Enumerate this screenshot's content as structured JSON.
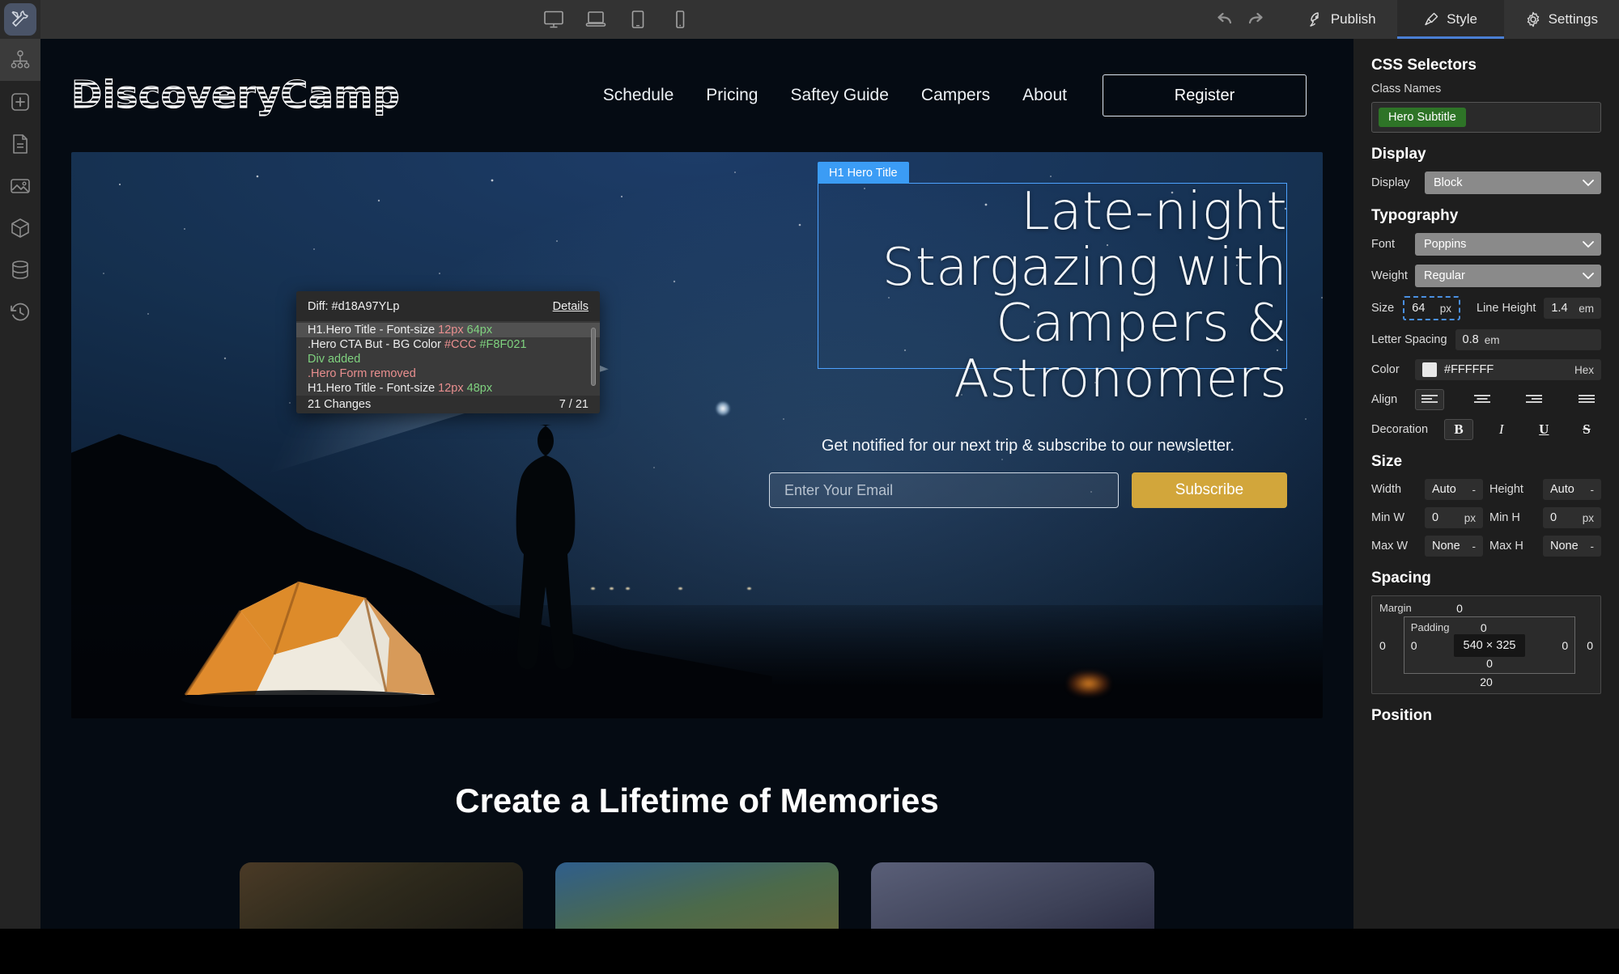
{
  "topbar": {
    "devices": [
      {
        "name": "desktop-view",
        "label": "Desktop"
      },
      {
        "name": "laptop-view",
        "label": "Laptop"
      },
      {
        "name": "tablet-view",
        "label": "Tablet"
      },
      {
        "name": "mobile-view",
        "label": "Mobile"
      }
    ],
    "undo_label": "Undo",
    "redo_label": "Redo",
    "publish_label": "Publish",
    "style_label": "Style",
    "settings_label": "Settings",
    "active_tab": "Style",
    "accent_color": "#4a7fd4"
  },
  "rail": {
    "items": [
      {
        "icon": "tools-icon",
        "label": "Tools",
        "active": true
      },
      {
        "icon": "sitemap-icon",
        "label": "Site Map",
        "active": false
      },
      {
        "icon": "add-box-icon",
        "label": "Add Element",
        "active": false
      },
      {
        "icon": "document-icon",
        "label": "Pages",
        "active": false
      },
      {
        "icon": "image-icon",
        "label": "Media",
        "active": false
      },
      {
        "icon": "cube-icon",
        "label": "Components",
        "active": false
      },
      {
        "icon": "database-icon",
        "label": "Data",
        "active": false
      },
      {
        "icon": "history-icon",
        "label": "History",
        "active": false
      }
    ]
  },
  "site": {
    "logo_text": "DiscoveryCamp",
    "nav": [
      {
        "label": "Schedule"
      },
      {
        "label": "Pricing"
      },
      {
        "label": "Saftey Guide"
      },
      {
        "label": "Campers"
      },
      {
        "label": "About"
      }
    ],
    "register_label": "Register",
    "hero": {
      "badge": "H1 Hero Title",
      "title": "Late-night Stargazing with Campers & Astronomers",
      "subtitle": "Get notified for our next trip & subscribe to our newsletter.",
      "email_placeholder": "Enter Your Email",
      "email_value": "",
      "subscribe_label": "Subscribe",
      "subscribe_color": "#D2A63B",
      "selection_color": "#4DA2FF"
    },
    "section_title": "Create a Lifetime of Memories"
  },
  "diff": {
    "title": "Diff: #d18A97YLp",
    "details_label": "Details",
    "rows": [
      {
        "prefix": "H1.Hero Title - Font-size",
        "old": "12px",
        "new": "64px",
        "kind": "change",
        "selected": true
      },
      {
        "prefix": ".Hero CTA But - BG Color",
        "old": "#CCC",
        "new": "#F8F021",
        "kind": "change",
        "selected": false
      },
      {
        "prefix": "Div added",
        "old": "",
        "new": "",
        "kind": "added",
        "selected": false
      },
      {
        "prefix": ".Hero Form removed",
        "old": "",
        "new": "",
        "kind": "removed",
        "selected": false
      },
      {
        "prefix": "H1.Hero Title - Font-size",
        "old": "12px",
        "new": "48px",
        "kind": "change",
        "selected": false
      }
    ],
    "footer_count": "21 Changes",
    "footer_position": "7 / 21"
  },
  "inspector": {
    "css_selectors_heading": "CSS Selectors",
    "class_names_label": "Class Names",
    "class_chip": "Hero Subtitle",
    "class_chip_color": "#2E7427",
    "display_heading": "Display",
    "display_label": "Display",
    "display_value": "Block",
    "typography_heading": "Typography",
    "font_label": "Font",
    "font_value": "Poppins",
    "weight_label": "Weight",
    "weight_value": "Regular",
    "size_label": "Size",
    "size_value": "64",
    "size_unit": "px",
    "line_height_label": "Line Height",
    "line_height_value": "1.4",
    "line_height_unit": "em",
    "letter_spacing_label": "Letter Spacing",
    "letter_spacing_value": "0.8",
    "letter_spacing_unit": "em",
    "color_label": "Color",
    "color_value": "#FFFFFF",
    "color_mode": "Hex",
    "align_label": "Align",
    "align_options": [
      "left",
      "center",
      "right",
      "justify"
    ],
    "align_active": "left",
    "decoration_label": "Decoration",
    "decoration_options": [
      "B",
      "I",
      "U",
      "S"
    ],
    "decoration_active": "B",
    "size_heading": "Size",
    "width_label": "Width",
    "width_value": "Auto",
    "width_unit": "-",
    "height_label": "Height",
    "height_value": "Auto",
    "height_unit": "-",
    "min_w_label": "Min W",
    "min_w_value": "0",
    "min_w_unit": "px",
    "min_h_label": "Min H",
    "min_h_value": "0",
    "min_h_unit": "px",
    "max_w_label": "Max W",
    "max_w_value": "None",
    "max_w_unit": "-",
    "max_h_label": "Max H",
    "max_h_value": "None",
    "max_h_unit": "-",
    "spacing_heading": "Spacing",
    "margin_label": "Margin",
    "margin_top": "0",
    "margin_right": "0",
    "margin_bottom": "20",
    "margin_left": "0",
    "padding_label": "Padding",
    "padding_top": "0",
    "padding_right": "0",
    "padding_bottom": "0",
    "padding_left": "0",
    "content_size": "540 × 325",
    "position_heading": "Position"
  }
}
